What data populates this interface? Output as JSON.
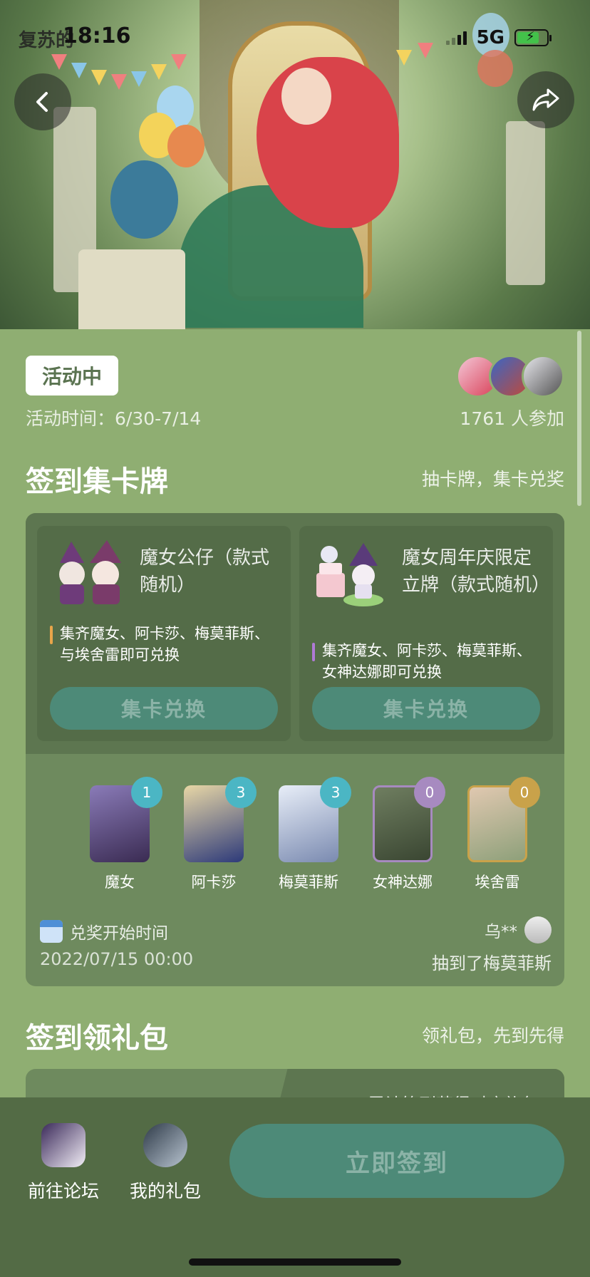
{
  "status_bar": {
    "time": "18:16",
    "game_logo": "复苏的",
    "network": "5G"
  },
  "header": {
    "back_icon": "chevron-left-icon",
    "share_icon": "share-icon"
  },
  "activity": {
    "status": "活动中",
    "time": "活动时间：6/30-7/14",
    "participants": "1761 人参加"
  },
  "section_cards": {
    "title": "签到集卡牌",
    "subtitle": "抽卡牌，集卡兑奖"
  },
  "rewards": [
    {
      "name": "魔女公仔（款式随机）",
      "condition": "集齐魔女、阿卡莎、梅莫菲斯、与埃舍雷即可兑换",
      "button": "集卡兑换",
      "accent": "#e8a54a"
    },
    {
      "name": "魔女周年庆限定立牌（款式随机）",
      "condition": "集齐魔女、阿卡莎、梅莫菲斯、女神达娜即可兑换",
      "button": "集卡兑换",
      "accent": "#b07ad6"
    }
  ],
  "cards": [
    {
      "name": "魔女",
      "count": "1",
      "badge_color": "#4bb6c4"
    },
    {
      "name": "阿卡莎",
      "count": "3",
      "badge_color": "#4bb6c4"
    },
    {
      "name": "梅莫菲斯",
      "count": "3",
      "badge_color": "#4bb6c4"
    },
    {
      "name": "女神达娜",
      "count": "0",
      "badge_color": "#a78ac0"
    },
    {
      "name": "埃舍雷",
      "count": "0",
      "badge_color": "#c9a24a"
    }
  ],
  "redeem": {
    "label": "兑奖开始时间",
    "date": "2022/07/15 00:00"
  },
  "winner": {
    "user": "乌**",
    "text": "抽到了梅莫菲斯"
  },
  "section_gifts": {
    "title": "签到领礼包",
    "subtitle": "领礼包，先到先得",
    "note": "累计签到获得对应礼包"
  },
  "bottom_bar": {
    "forum": "前往论坛",
    "my_gifts": "我的礼包",
    "checkin": "立即签到"
  }
}
